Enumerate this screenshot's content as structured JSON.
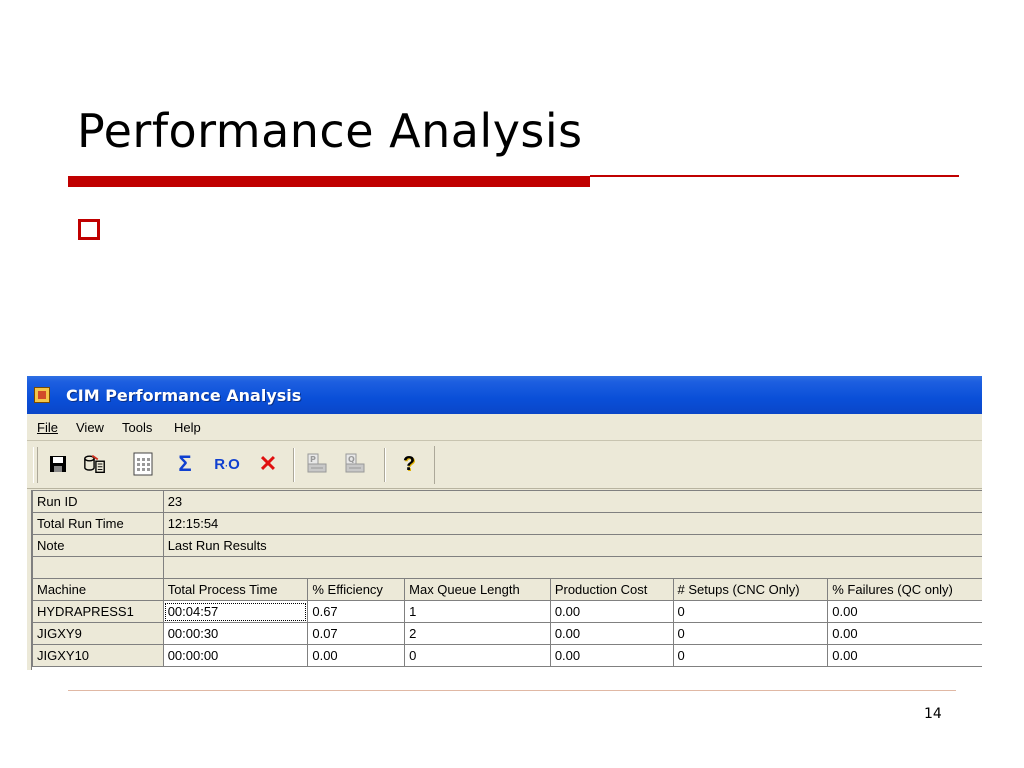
{
  "slide": {
    "title": "Performance Analysis",
    "page_number": "14",
    "accent_color": "#c00000"
  },
  "window": {
    "title": "CIM Performance Analysis",
    "icon": "app-icon",
    "titlebar_color": "#0a4fd8"
  },
  "menu": {
    "items": [
      "File",
      "View",
      "Tools",
      "Help"
    ]
  },
  "toolbar": {
    "buttons": [
      {
        "name": "save-icon",
        "glyph": "🖫"
      },
      {
        "name": "export-icon",
        "glyph": "⛁"
      },
      {
        "name": "calculator-icon",
        "glyph": "▦"
      },
      {
        "name": "sigma-icon",
        "glyph": "Σ"
      },
      {
        "name": "ro-icon",
        "glyph": "R·O"
      },
      {
        "name": "delete-icon",
        "glyph": "✕"
      },
      {
        "name": "print-preview-icon",
        "glyph": "⎙"
      },
      {
        "name": "print-icon",
        "glyph": "⎙"
      },
      {
        "name": "help-icon",
        "glyph": "?"
      }
    ]
  },
  "run_info": {
    "rows": [
      {
        "label": "Run ID",
        "value": "23"
      },
      {
        "label": "Total Run Time",
        "value": "12:15:54"
      },
      {
        "label": "Note",
        "value": "Last Run Results"
      }
    ]
  },
  "table": {
    "columns": [
      "Machine",
      "Total Process Time",
      "% Efficiency",
      "Max Queue Length",
      "Production Cost",
      "# Setups (CNC Only)",
      "% Failures (QC only)"
    ],
    "rows": [
      [
        "HYDRAPRESS1",
        "00:04:57",
        "0.67",
        "1",
        "0.00",
        "0",
        "0.00"
      ],
      [
        "JIGXY9",
        "00:00:30",
        "0.07",
        "2",
        "0.00",
        "0",
        "0.00"
      ],
      [
        "JIGXY10",
        "00:00:00",
        "0.00",
        "0",
        "0.00",
        "0",
        "0.00"
      ]
    ]
  }
}
